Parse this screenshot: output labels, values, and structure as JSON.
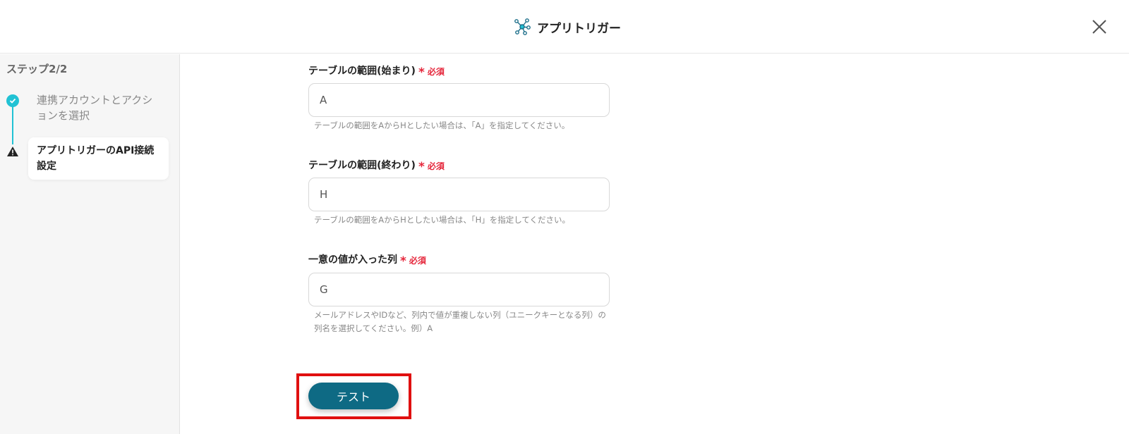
{
  "header": {
    "title": "アプリトリガー",
    "app_icon": "network-nodes-icon",
    "close_icon": "close-icon"
  },
  "sidebar": {
    "step_label": "ステップ2/2",
    "steps": [
      {
        "label": "連携アカウントとアクションを選択",
        "status": "completed",
        "icon": "check-circle-icon"
      },
      {
        "label": "アプリトリガーのAPI接続設定",
        "status": "current-warning",
        "icon": "warning-icon"
      }
    ]
  },
  "form": {
    "required_text": "必須",
    "required_mark": "*",
    "fields": [
      {
        "label": "テーブルの範囲(始まり)",
        "value": "A",
        "help": "テーブルの範囲をAからHとしたい場合は、「A」を指定してください。"
      },
      {
        "label": "テーブルの範囲(終わり)",
        "value": "H",
        "help": "テーブルの範囲をAからHとしたい場合は、「H」を指定してください。"
      },
      {
        "label": "一意の値が入った列",
        "value": "G",
        "help": "メールアドレスやIDなど、列内で値が重複しない列（ユニークキーとなる列）の列名を選択してください。例）A"
      }
    ]
  },
  "actions": {
    "test_label": "テスト"
  },
  "colors": {
    "accent": "#21c2d4",
    "primary_button": "#0e6a84",
    "required": "#e5263b",
    "highlight": "#e01010"
  }
}
